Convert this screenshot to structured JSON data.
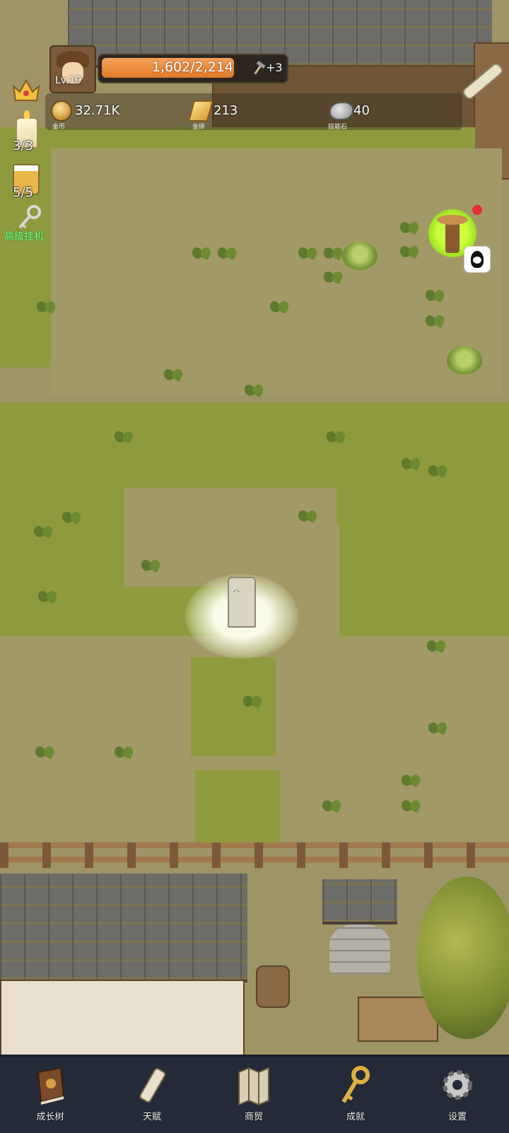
{
  "player": {
    "level": "Lv.19",
    "xp_text": "1,602/2,214",
    "xp_fraction": 0.7236,
    "bonus": "+3"
  },
  "resources": [
    {
      "icon": "coin-icon",
      "value": "32.71K",
      "caption": "金币"
    },
    {
      "icon": "gold-bar-icon",
      "value": "213",
      "caption": "金砖"
    },
    {
      "icon": "skill-stone-icon",
      "value": "40",
      "caption": "技能石"
    }
  ],
  "side": {
    "candle_count": "3/3",
    "drink_count": "5/5",
    "idle_label": "高级挂机"
  },
  "nav": [
    {
      "label": "成长树",
      "icon": "book-icon"
    },
    {
      "label": "天赋",
      "icon": "scroll-icon"
    },
    {
      "label": "商贸",
      "icon": "map-icon"
    },
    {
      "label": "成就",
      "icon": "key-icon"
    },
    {
      "label": "设置",
      "icon": "gear-icon"
    }
  ],
  "colors": {
    "xp_fill": "#e88a3a",
    "nav_bg": "#242a38",
    "idle_text": "#7dff7d",
    "grass": "#8f9a3e",
    "dirt": "#a39967"
  }
}
